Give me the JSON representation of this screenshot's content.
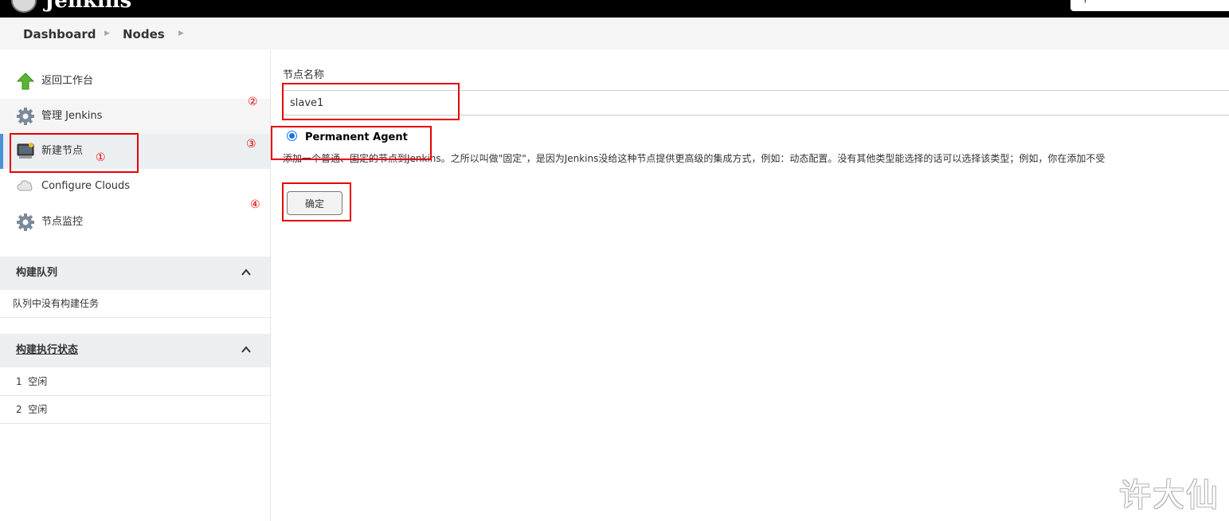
{
  "header": {
    "logo_text": "Jenkins",
    "search_icon": "search-icon"
  },
  "breadcrumb": {
    "items": [
      "Dashboard",
      "Nodes"
    ],
    "separator_icon": "chevron-right-icon"
  },
  "sidebar": {
    "items": [
      {
        "label": "返回工作台",
        "icon": "up-arrow-icon"
      },
      {
        "label": "管理 Jenkins",
        "icon": "gear-icon"
      },
      {
        "label": "新建节点",
        "icon": "computer-icon"
      },
      {
        "label": "Configure Clouds",
        "icon": "cloud-icon"
      },
      {
        "label": "节点监控",
        "icon": "gear-icon"
      }
    ]
  },
  "build_queue": {
    "title": "构建队列",
    "empty_text": "队列中没有构建任务",
    "collapse_icon": "chevron-up-icon"
  },
  "executors": {
    "title": "构建执行状态",
    "rows": [
      {
        "number": "1",
        "status": "空闲"
      },
      {
        "number": "2",
        "status": "空闲"
      }
    ],
    "collapse_icon": "chevron-up-icon"
  },
  "form": {
    "name_label": "节点名称",
    "name_value": "slave1",
    "option_label": "Permanent Agent",
    "option_selected": true,
    "option_description": "添加一个普通、固定的节点到Jenkins。之所以叫做\"固定\"，是因为Jenkins没给这种节点提供更高级的集成方式，例如：动态配置。没有其他类型能选择的话可以选择该类型；例如，你在添加不受",
    "ok_label": "确定"
  },
  "annotations": {
    "markers": [
      "①",
      "②",
      "③",
      "④"
    ],
    "color": "#e60000"
  },
  "watermark": "许大仙",
  "colors": {
    "topbar": "#000000",
    "active_indicator": "#4a90d9",
    "radio": "#1a73e8"
  }
}
